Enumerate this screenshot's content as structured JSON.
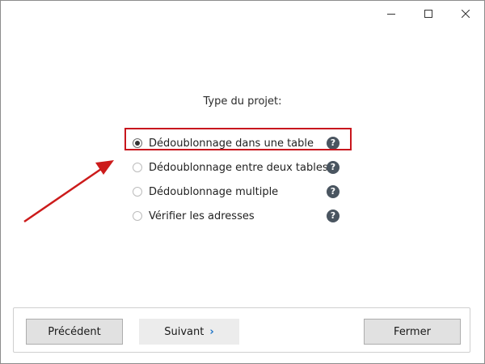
{
  "window_controls": {
    "minimize": "minimize-icon",
    "maximize": "maximize-icon",
    "close": "close-icon"
  },
  "dialog": {
    "title": "Type du projet:"
  },
  "options": [
    {
      "label": "Dédoublonnage dans une table",
      "checked": true
    },
    {
      "label": "Dédoublonnage entre deux tables",
      "checked": false
    },
    {
      "label": "Dédoublonnage multiple",
      "checked": false
    },
    {
      "label": "Vérifier les adresses",
      "checked": false
    }
  ],
  "help_icon_glyph": "?",
  "footer": {
    "prev_label": "Précédent",
    "next_label": "Suivant",
    "next_chevron": "›",
    "close_label": "Fermer"
  },
  "colors": {
    "highlight": "#c8161d",
    "arrow": "#cc1b1b",
    "help_icon_bg": "#4a5560",
    "next_chevron": "#1a73c8"
  }
}
